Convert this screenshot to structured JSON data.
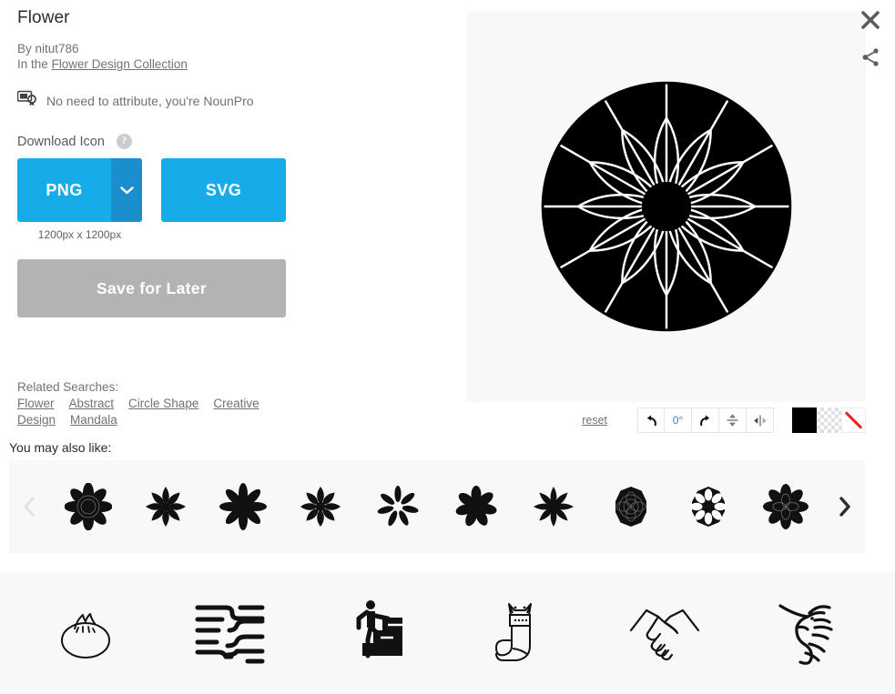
{
  "header": {
    "title": "Flower",
    "by_label": "By nitut786",
    "in_the_label": "In the",
    "collection_link": "Flower Design Collection"
  },
  "attribution": {
    "icon": "certificate-badge-icon",
    "text": "No need to attribute, you're NounPro"
  },
  "download": {
    "section_label": "Download Icon",
    "help_icon": "question-mark-icon",
    "help_glyph": "?",
    "png_label": "PNG",
    "png_caret_icon": "chevron-down-icon",
    "svg_label": "SVG",
    "size_label": "1200px x 1200px",
    "save_later_label": "Save for Later",
    "accent_color": "#17ace9",
    "accent_dark_color": "#1b8ecd",
    "save_later_color": "#b3b3b3"
  },
  "related": {
    "heading": "Related Searches:",
    "tags": [
      "Flower",
      "Abstract",
      "Circle Shape",
      "Creative",
      "Design",
      "Mandala"
    ]
  },
  "preview": {
    "panel_color": "#f8f8f8",
    "artwork_name": "flower-mandala-artwork",
    "artwork_fill": "#000000",
    "close_icon": "close-icon",
    "share_icon": "share-icon"
  },
  "editor_toolbar": {
    "reset_label": "reset",
    "rotate_left_icon": "rotate-left-icon",
    "rotation_value": "0°",
    "rotate_right_icon": "rotate-right-icon",
    "flip_vertical_icon": "flip-vertical-icon",
    "flip_horizontal_icon": "flip-horizontal-icon",
    "swatches": [
      {
        "name": "swatch-black",
        "color": "#000000"
      },
      {
        "name": "swatch-transparent",
        "color": "transparent"
      },
      {
        "name": "swatch-no-color",
        "color": "#ffffff"
      }
    ]
  },
  "also_like": {
    "heading": "You may also like:",
    "prev_icon": "chevron-left-icon",
    "next_icon": "chevron-right-icon",
    "thumbnails": [
      {
        "name": "thumb-flower-1",
        "kind": "layered-rosette"
      },
      {
        "name": "thumb-flower-2",
        "kind": "eight-petal-open"
      },
      {
        "name": "thumb-flower-3",
        "kind": "eight-petal-solid"
      },
      {
        "name": "thumb-flower-4",
        "kind": "eight-petal-pinwheel"
      },
      {
        "name": "thumb-flower-5",
        "kind": "seven-petal-thin"
      },
      {
        "name": "thumb-flower-6",
        "kind": "seven-petal-round"
      },
      {
        "name": "thumb-flower-7",
        "kind": "eight-petal-star"
      },
      {
        "name": "thumb-flower-8",
        "kind": "rounded-mandala"
      },
      {
        "name": "thumb-flower-9",
        "kind": "octagon-mandala"
      },
      {
        "name": "thumb-flower-10",
        "kind": "layered-rosette-2"
      }
    ]
  },
  "bottom_strip": {
    "icons": [
      {
        "name": "bottom-icon-dumpling",
        "label": "dumpling-icon"
      },
      {
        "name": "bottom-icon-abstract-lines",
        "label": "abstract-lines-icon"
      },
      {
        "name": "bottom-icon-stairs-climb",
        "label": "person-climbing-stairs-icon"
      },
      {
        "name": "bottom-icon-cat-sock",
        "label": "cat-sock-icon"
      },
      {
        "name": "bottom-icon-handshake",
        "label": "handshake-icon"
      },
      {
        "name": "bottom-icon-seahorse",
        "label": "seahorse-icon"
      }
    ]
  }
}
